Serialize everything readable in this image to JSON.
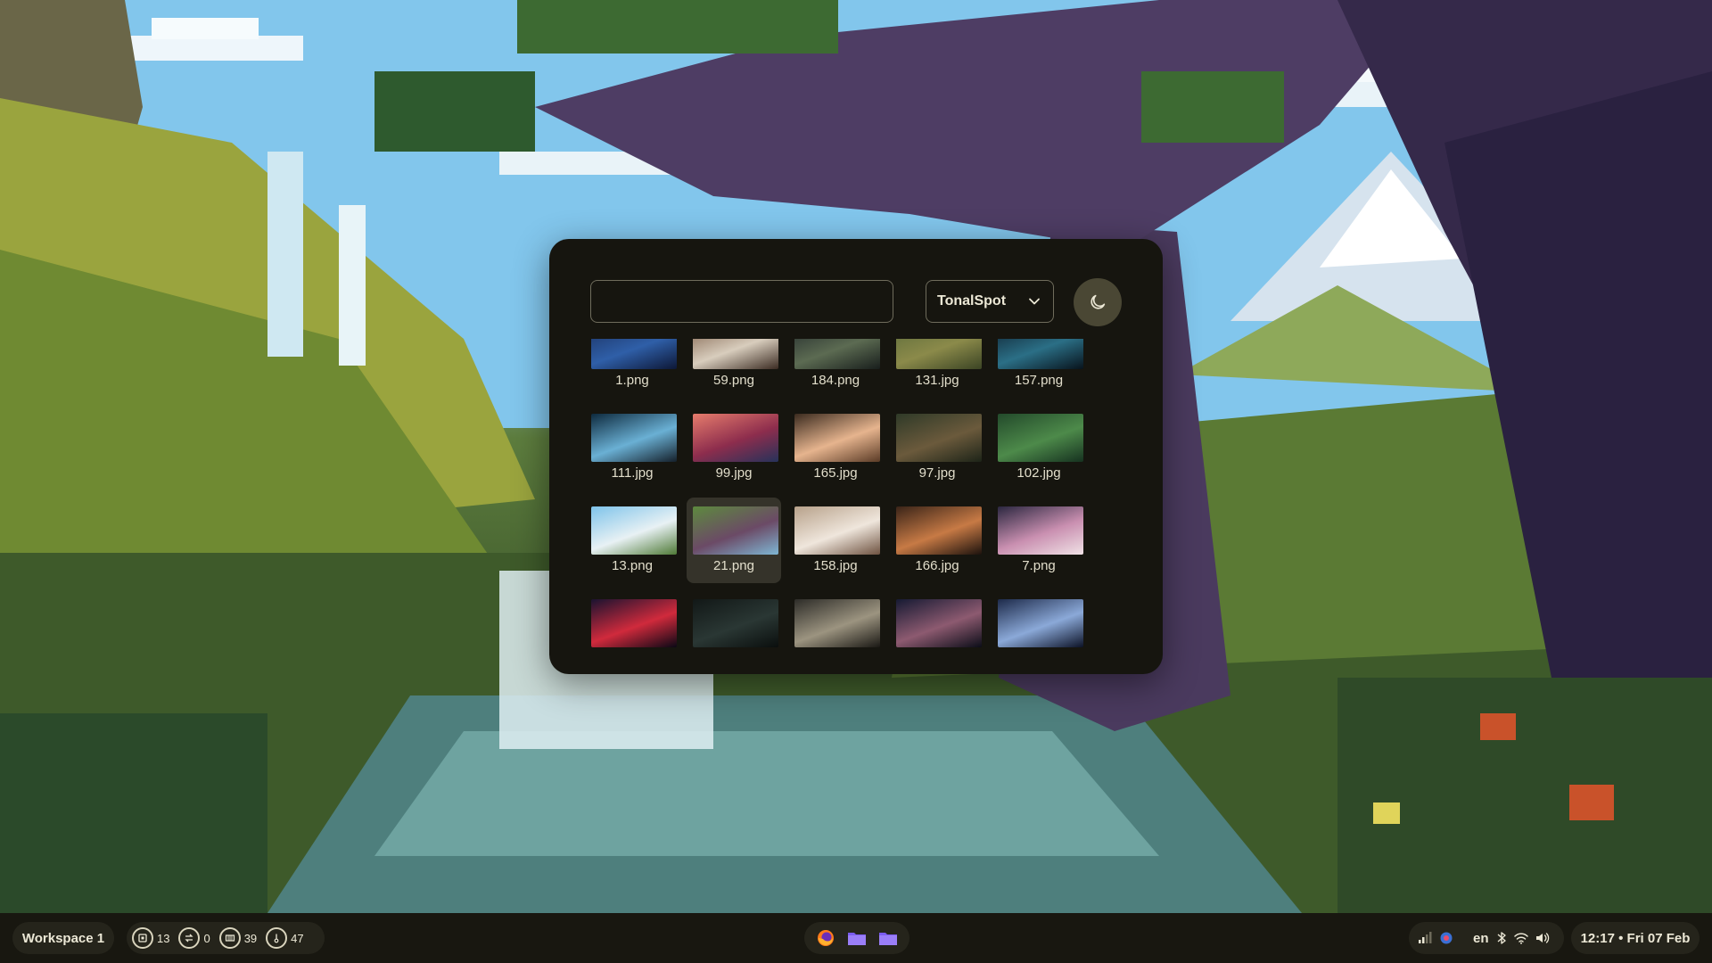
{
  "picker": {
    "search": {
      "value": "",
      "placeholder": ""
    },
    "scheme": {
      "selected": "TonalSpot"
    },
    "mode_icon": "moon-icon",
    "thumbnails": [
      {
        "label": "1.png",
        "colors": [
          "#1a2f5e",
          "#2f5fa8",
          "#0d1736"
        ]
      },
      {
        "label": "59.png",
        "colors": [
          "#7a5b45",
          "#d8cdbd",
          "#3b2b22"
        ]
      },
      {
        "label": "184.png",
        "colors": [
          "#20282a",
          "#5c6b52",
          "#181e1c"
        ]
      },
      {
        "label": "131.jpg",
        "colors": [
          "#5a6a3a",
          "#8b8a4a",
          "#3b4424"
        ]
      },
      {
        "label": "157.png",
        "colors": [
          "#0d1d2c",
          "#2b6f86",
          "#08131c"
        ]
      },
      {
        "label": "111.jpg",
        "colors": [
          "#0e2a3e",
          "#6ab0d4",
          "#15202a"
        ]
      },
      {
        "label": "99.jpg",
        "colors": [
          "#e67c6c",
          "#8d2d4d",
          "#26325a"
        ]
      },
      {
        "label": "165.jpg",
        "colors": [
          "#3b2b1f",
          "#e6b48e",
          "#5a3b26"
        ]
      },
      {
        "label": "97.jpg",
        "colors": [
          "#2f3a28",
          "#6b5a3c",
          "#1d2418"
        ]
      },
      {
        "label": "102.jpg",
        "colors": [
          "#234a2b",
          "#4d8a4a",
          "#163220"
        ]
      },
      {
        "label": "13.png",
        "colors": [
          "#7ec3ea",
          "#e8f1f4",
          "#4f7a36"
        ]
      },
      {
        "label": "21.png",
        "colors": [
          "#5d8a3e",
          "#6b4a66",
          "#7fb7d4"
        ]
      },
      {
        "label": "158.jpg",
        "colors": [
          "#b7a18a",
          "#efe6dc",
          "#6e5240"
        ]
      },
      {
        "label": "166.jpg",
        "colors": [
          "#3a2418",
          "#c77a45",
          "#1c120d"
        ]
      },
      {
        "label": "7.png",
        "colors": [
          "#2b2740",
          "#c98fb0",
          "#f0e2e6"
        ]
      },
      {
        "label": "",
        "colors": [
          "#1a1330",
          "#d02a3c",
          "#0a0815"
        ]
      },
      {
        "label": "",
        "colors": [
          "#121817",
          "#2a3734",
          "#0a0e0d"
        ]
      },
      {
        "label": "",
        "colors": [
          "#2d2c28",
          "#9c9480",
          "#1a1814"
        ]
      },
      {
        "label": "",
        "colors": [
          "#161a33",
          "#8d5a70",
          "#0b0d18"
        ]
      },
      {
        "label": "",
        "colors": [
          "#1d2a4a",
          "#8ba9d8",
          "#0c1226"
        ]
      }
    ],
    "selected_index": 11
  },
  "bar": {
    "workspace": "Workspace 1",
    "stats": [
      {
        "icon": "cpu-icon",
        "value": "13"
      },
      {
        "icon": "swap-icon",
        "value": "0"
      },
      {
        "icon": "memory-icon",
        "value": "39"
      },
      {
        "icon": "temperature-icon",
        "value": "47"
      }
    ],
    "apps": [
      "firefox-icon",
      "folder-icon",
      "folder-icon"
    ],
    "system": {
      "language": "en",
      "icons": [
        "signal-icon",
        "bluetooth-icon",
        "wifi-icon",
        "volume-icon"
      ]
    },
    "clock": "12:17 • Fri 07 Feb"
  },
  "colors": {
    "panel_bg": "#16150f",
    "bar_bg": "#181710",
    "pill_bg": "#25241b",
    "accent": "#4a4734",
    "text": "#ece8d6"
  }
}
